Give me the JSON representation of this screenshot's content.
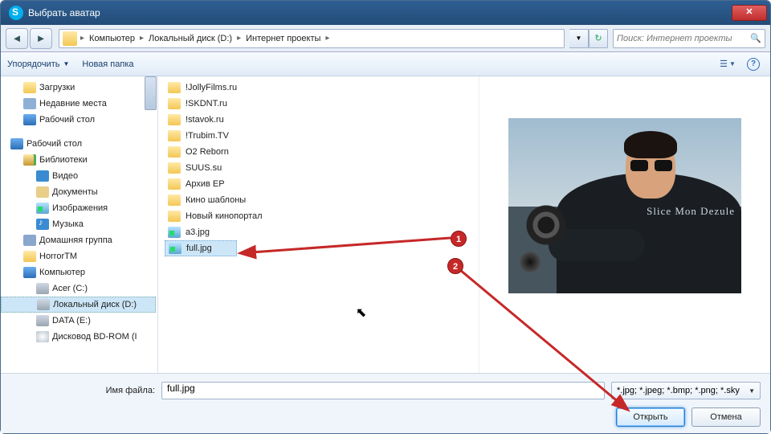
{
  "titlebar": {
    "icon": "skype",
    "title": "Выбрать аватар",
    "close": "✕"
  },
  "nav": {
    "back": "◄",
    "fwd": "►",
    "crumbs": [
      "Компьютер",
      "Локальный диск (D:)",
      "Интернет проекты"
    ],
    "refresh": "↻",
    "search_placeholder": "Поиск: Интернет проекты"
  },
  "toolbar": {
    "organize": "Упорядочить",
    "newfolder": "Новая папка",
    "help": "?"
  },
  "sidebar": {
    "items": [
      {
        "label": "Загрузки",
        "icon": "ic-folder",
        "indent": 1
      },
      {
        "label": "Недавние места",
        "icon": "ic-net",
        "indent": 1
      },
      {
        "label": "Рабочий стол",
        "icon": "ic-monitor",
        "indent": 1
      },
      {
        "label": "",
        "icon": "",
        "indent": 0,
        "spacer": true
      },
      {
        "label": "Рабочий стол",
        "icon": "ic-monitor",
        "indent": 0
      },
      {
        "label": "Библиотеки",
        "icon": "ic-lib",
        "indent": 1
      },
      {
        "label": "Видео",
        "icon": "ic-video",
        "indent": 2
      },
      {
        "label": "Документы",
        "icon": "ic-doc",
        "indent": 2
      },
      {
        "label": "Изображения",
        "icon": "ic-photo",
        "indent": 2
      },
      {
        "label": "Музыка",
        "icon": "ic-music",
        "indent": 2
      },
      {
        "label": "Домашняя группа",
        "icon": "ic-home",
        "indent": 1
      },
      {
        "label": "HorrorTM",
        "icon": "ic-folder",
        "indent": 1
      },
      {
        "label": "Компьютер",
        "icon": "ic-monitor",
        "indent": 1
      },
      {
        "label": "Acer (C:)",
        "icon": "ic-hd",
        "indent": 2
      },
      {
        "label": "Локальный диск (D:)",
        "icon": "ic-hd",
        "indent": 2,
        "selected": true
      },
      {
        "label": "DATA (E:)",
        "icon": "ic-hd",
        "indent": 2
      },
      {
        "label": "Дисковод BD-ROM (I",
        "icon": "ic-disc",
        "indent": 2
      }
    ]
  },
  "files": {
    "items": [
      {
        "label": "!JollyFilms.ru",
        "icon": "ic-folder"
      },
      {
        "label": "!SKDNT.ru",
        "icon": "ic-folder"
      },
      {
        "label": "!stavok.ru",
        "icon": "ic-folder"
      },
      {
        "label": "!Trubim.TV",
        "icon": "ic-folder"
      },
      {
        "label": "O2 Reborn",
        "icon": "ic-folder"
      },
      {
        "label": "SUUS.su",
        "icon": "ic-folder"
      },
      {
        "label": "Архив EP",
        "icon": "ic-folder"
      },
      {
        "label": "Кино шаблоны",
        "icon": "ic-folder"
      },
      {
        "label": "Новый кинопортал",
        "icon": "ic-folder"
      },
      {
        "label": "a3.jpg",
        "icon": "ic-photo"
      },
      {
        "label": "full.jpg",
        "icon": "ic-photo",
        "selected": true
      }
    ]
  },
  "preview": {
    "watermark": "Slice  Mon Dezule"
  },
  "bottom": {
    "fn_label": "Имя файла:",
    "fn_value": "full.jpg",
    "filter": "*.jpg; *.jpeg; *.bmp; *.png; *.sky",
    "open": "Открыть",
    "cancel": "Отмена"
  },
  "annotations": {
    "step1": "1",
    "step2": "2"
  }
}
